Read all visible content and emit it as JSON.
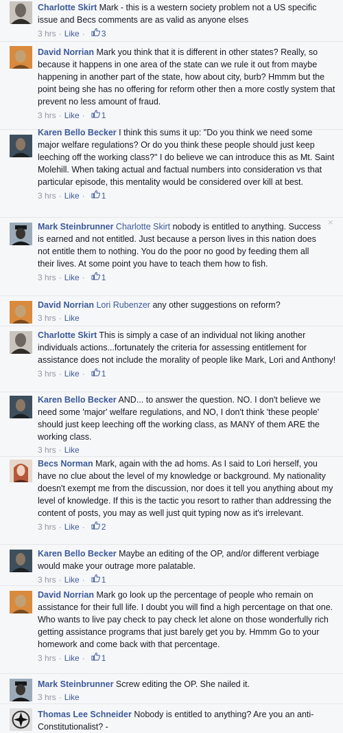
{
  "comments": [
    {
      "author": "Charlotte Skirt",
      "mention": "",
      "text": "Mark - this is a western society problem not a US specific issue and Becs comments are as valid as anyone elses",
      "time": "3 hrs",
      "like_label": "Like",
      "likes": "3",
      "avatar_icon": "grayscale-woman-portrait-icon",
      "avatar_colors": [
        "#c9c4bd",
        "#6d6660",
        "#2f2b29"
      ]
    },
    {
      "author": "David Norrian",
      "mention": "",
      "text": "Mark you think that it is different in other states? Really, so because it happens in one area of the state can we rule it out from maybe happening in another part of the state, how about city, burb? Hmmm but the point being she has no offering for reform other then a more costly system that prevent no less amount of fraud.",
      "time": "3 hrs",
      "like_label": "Like",
      "likes": "1",
      "avatar_icon": "orange-man-portrait-icon",
      "avatar_colors": [
        "#d98a3c",
        "#c2a176",
        "#7a4a1e"
      ]
    },
    {
      "author": "Karen Bello Becker",
      "mention": "",
      "text": "I think this sums it up: \"Do you think we need some major welfare regulations? Or do you think these people should just keep leeching off the working class?\" I do believe we can introduce this as Mt. Saint Molehill. When taking actual and factual numbers into consideration vs that particular episode, this mentality would be considered over kill at best.",
      "time": "3 hrs",
      "like_label": "Like",
      "likes": "1",
      "avatar_icon": "dark-woman-portrait-icon",
      "avatar_colors": [
        "#3d4f5c",
        "#8b7766",
        "#1c2124"
      ]
    },
    {
      "author": "Mark Steinbrunner",
      "mention": "Charlotte Skirt",
      "text": "nobody is entitled to anything. Success is earned and not entitled. Just because a person lives in this nation does not entitle them to nothing. You do the poor no good by feeding them all their lives. At some point you have to teach them how to fish.",
      "time": "3 hrs",
      "like_label": "Like",
      "likes": "1",
      "avatar_icon": "man-with-cap-portrait-icon",
      "avatar_colors": [
        "#9aaab8",
        "#3a3430",
        "#16181a"
      ],
      "close": "×"
    },
    {
      "author": "David Norrian",
      "mention": "Lori Rubenzer",
      "text": "any other suggestions on reform?",
      "time": "3 hrs",
      "like_label": "Like",
      "likes": "",
      "avatar_icon": "orange-man-portrait-icon",
      "avatar_colors": [
        "#d98a3c",
        "#c2a176",
        "#7a4a1e"
      ]
    },
    {
      "author": "Charlotte Skirt",
      "mention": "",
      "text": "This is simply a case of an individual not liking another individuals actions...fortunately the criteria for assessing entitlement for assistance does not include the morality of people like Mark, Lori and Anthony!",
      "time": "3 hrs",
      "like_label": "Like",
      "likes": "1",
      "avatar_icon": "grayscale-woman-portrait-icon",
      "avatar_colors": [
        "#c9c4bd",
        "#6d6660",
        "#2f2b29"
      ]
    },
    {
      "author": "Karen Bello Becker",
      "mention": "",
      "text": "AND... to answer the question. NO. I don't believe we need some 'major' welfare regulations, and NO, I don't think 'these people' should just keep leeching off the working class, as MANY of them ARE the working class.",
      "time": "3 hrs",
      "like_label": "Like",
      "likes": "",
      "avatar_icon": "dark-woman-portrait-icon",
      "avatar_colors": [
        "#3d4f5c",
        "#8b7766",
        "#1c2124"
      ]
    },
    {
      "author": "Becs Norman",
      "mention": "",
      "text": "Mark, again with the ad homs. As I said to Lori herself, you have no clue about the level of my knowledge or background. My nationality doesn't exempt me from the discussion, nor does it tell you anything about my level of knowledge. If this is the tactic you resort to rather than addressing the content of posts, you may as well just quit typing now as it's irrelevant.",
      "time": "3 hrs",
      "like_label": "Like",
      "likes": "2",
      "avatar_icon": "red-hair-woman-portrait-icon",
      "avatar_colors": [
        "#e8d7cc",
        "#b5573a",
        "#5a2a1c"
      ]
    },
    {
      "author": "Karen Bello Becker",
      "mention": "",
      "text": "Maybe an editing of the OP, and/or different verbiage would make your outrage more palatable.",
      "time": "3 hrs",
      "like_label": "Like",
      "likes": "1",
      "avatar_icon": "dark-woman-portrait-icon",
      "avatar_colors": [
        "#3d4f5c",
        "#8b7766",
        "#1c2124"
      ]
    },
    {
      "author": "David Norrian",
      "mention": "",
      "text": "Mark go look up the percentage of people who remain on assistance for their full life. I doubt you will find a high percentage on that one. Who wants to live pay check to pay check let alone on those wonderfully rich getting assistance programs that just barely get you by. Hmmm Go to your homework and come back with that percentage.",
      "time": "3 hrs",
      "like_label": "Like",
      "likes": "1",
      "avatar_icon": "orange-man-portrait-icon",
      "avatar_colors": [
        "#d98a3c",
        "#c2a176",
        "#7a4a1e"
      ]
    },
    {
      "author": "Mark Steinbrunner",
      "mention": "",
      "text": "Screw editing the OP. She nailed it.",
      "time": "3 hrs",
      "like_label": "Like",
      "likes": "",
      "avatar_icon": "man-with-cap-portrait-icon",
      "avatar_colors": [
        "#9aaab8",
        "#3a3430",
        "#16181a"
      ]
    },
    {
      "author": "Thomas Lee Schneider",
      "mention": "",
      "text": "Nobody is entitled to anything? Are you an anti-Constitutionalist? -",
      "time": "",
      "like_label": "",
      "likes": "",
      "avatar_icon": "emblem-portrait-icon",
      "avatar_colors": [
        "#e0e0e0",
        "#333333",
        "#111111"
      ]
    }
  ],
  "colors": {
    "link": "#3b5998",
    "meta": "#9197a3",
    "text": "#141823",
    "background": "#f6f7f9"
  }
}
